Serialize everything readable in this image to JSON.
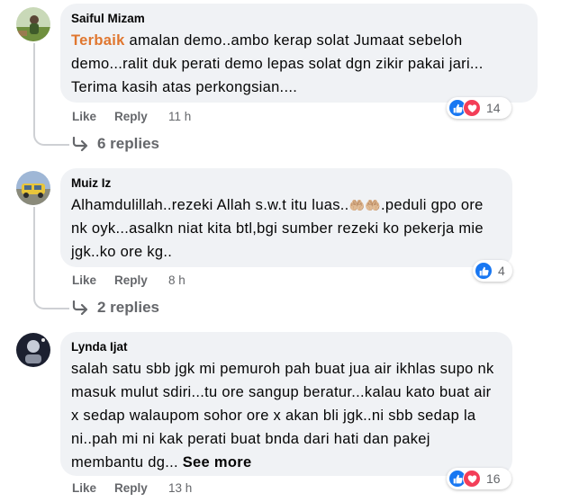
{
  "comments": [
    {
      "author": "Saiful Mizam",
      "tag": "Terbaik",
      "text": " amalan demo..ambo kerap solat Jumaat sebeloh demo...ralit duk perati demo lepas solat dgn zikir pakai jari... Terima kasih atas perkongsian....",
      "like_label": "Like",
      "reply_label": "Reply",
      "time": "11 h",
      "reaction_count": "14",
      "replies_label": "6 replies"
    },
    {
      "author": "Muiz Iz",
      "text_a": "Alhamdulillah..rezeki Allah s.w.t itu luas..",
      "emoji": "🤲🏼🤲🏼",
      "text_b": ".peduli gpo ore nk oyk...asalkn niat kita btl,bgi sumber rezeki ko pekerja mie jgk..ko ore kg..",
      "like_label": "Like",
      "reply_label": "Reply",
      "time": "8 h",
      "reaction_count": "4",
      "replies_label": "2 replies"
    },
    {
      "author": "Lynda Ijat",
      "text": "salah satu sbb jgk mi pemuroh pah buat jua air ikhlas supo nk masuk mulut sdiri...tu ore sangup beratur...kalau kato buat air x sedap walaupom sohor ore x akan bli jgk..ni sbb sedap la ni..pah mi ni kak perati buat bnda dari hati dan pakej membantu dg...",
      "see_more": "See more",
      "like_label": "Like",
      "reply_label": "Reply",
      "time": "13 h",
      "reaction_count": "16"
    }
  ],
  "icons": {
    "like": "like-icon",
    "love": "love-icon",
    "reply_arrow": "reply-arrow-icon"
  },
  "colors": {
    "bubble": "#f0f2f5",
    "secondary_text": "#65676b",
    "like_blue": "#1877f2",
    "love_red": "#f33e58",
    "tag_orange": "#e0762e"
  }
}
